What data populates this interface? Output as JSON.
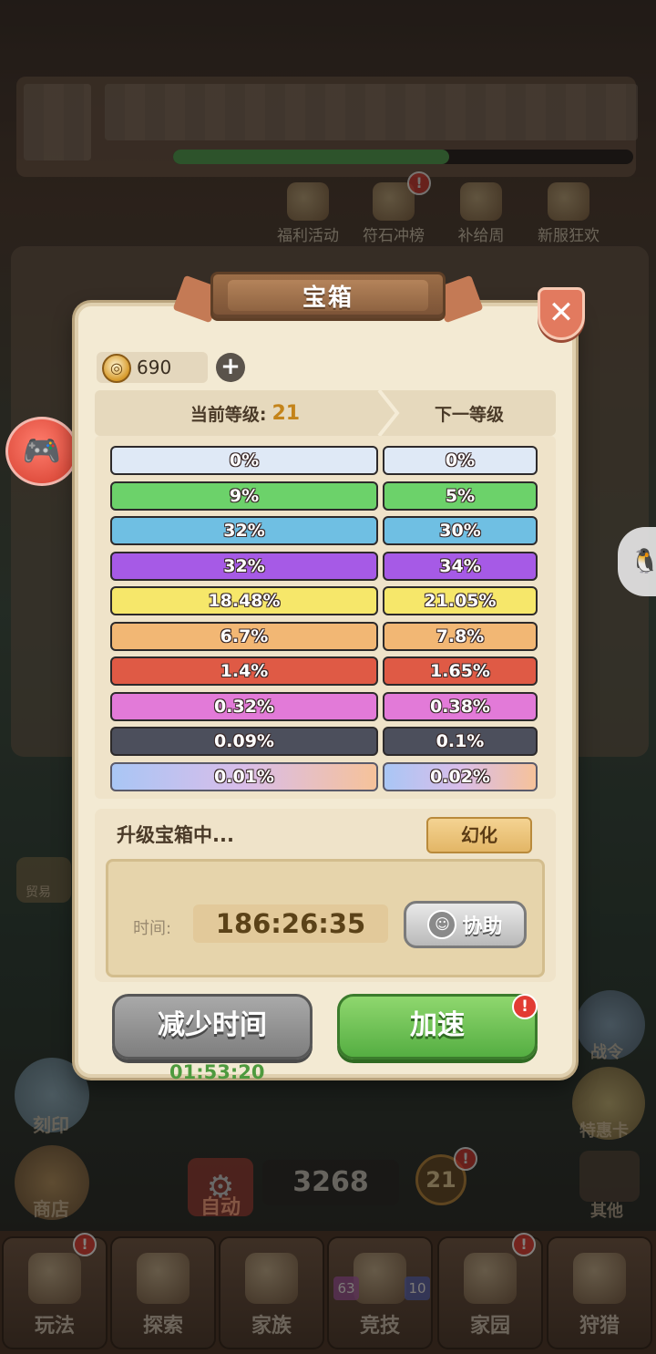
{
  "background": {
    "events": [
      {
        "label": "福利活动",
        "icon": "gift-icon"
      },
      {
        "label": "符石冲榜",
        "icon": "trophy-icon",
        "badge": "!"
      },
      {
        "label": "补给周",
        "icon": "supply-icon"
      },
      {
        "label": "新服狂欢",
        "icon": "party-icon"
      }
    ],
    "left_side": [
      {
        "label": "贸易"
      },
      {
        "label": "刻印"
      },
      {
        "label": "商店"
      }
    ],
    "right_side": [
      {
        "label": "战令"
      },
      {
        "label": "特惠卡"
      },
      {
        "label": "其他"
      }
    ],
    "auto_label": "自动",
    "score": "3268",
    "player_level_badge": "21",
    "nav": [
      {
        "label": "玩法",
        "badge": "!"
      },
      {
        "label": "探索"
      },
      {
        "label": "家族"
      },
      {
        "label": "竞技",
        "sub_left": "63",
        "sub_right": "10"
      },
      {
        "label": "家园",
        "badge": "!"
      },
      {
        "label": "狩猎"
      }
    ]
  },
  "modal": {
    "title": "宝箱",
    "close_icon": "✕",
    "currency": {
      "icon": "compass-coin-icon",
      "value": "690"
    },
    "current_level_label": "当前等级:",
    "current_level": "21",
    "next_level_label": "下一等级",
    "rates": [
      {
        "current": "0%",
        "next": "0%",
        "color": "#dfe9f6"
      },
      {
        "current": "9%",
        "next": "5%",
        "color": "#6cd26a"
      },
      {
        "current": "32%",
        "next": "30%",
        "color": "#6fbfe3"
      },
      {
        "current": "32%",
        "next": "34%",
        "color": "#a65ae6"
      },
      {
        "current": "18.48%",
        "next": "21.05%",
        "color": "#f6e76a"
      },
      {
        "current": "6.7%",
        "next": "7.8%",
        "color": "#f2b774"
      },
      {
        "current": "1.4%",
        "next": "1.65%",
        "color": "#df5a45"
      },
      {
        "current": "0.32%",
        "next": "0.38%",
        "color": "#e27ad8"
      },
      {
        "current": "0.09%",
        "next": "0.1%",
        "color": "#4c4f5c"
      },
      {
        "current": "0.01%",
        "next": "0.02%",
        "color": "gradient"
      }
    ],
    "upgrade_status": "升级宝箱中...",
    "morph_label": "幻化",
    "time_label": "时间:",
    "time_value": "186:26:35",
    "assist_label": "协助",
    "reduce_label": "减少时间",
    "speed_label": "加速",
    "speed_badge": "!",
    "cooldown": "01:53:20"
  }
}
